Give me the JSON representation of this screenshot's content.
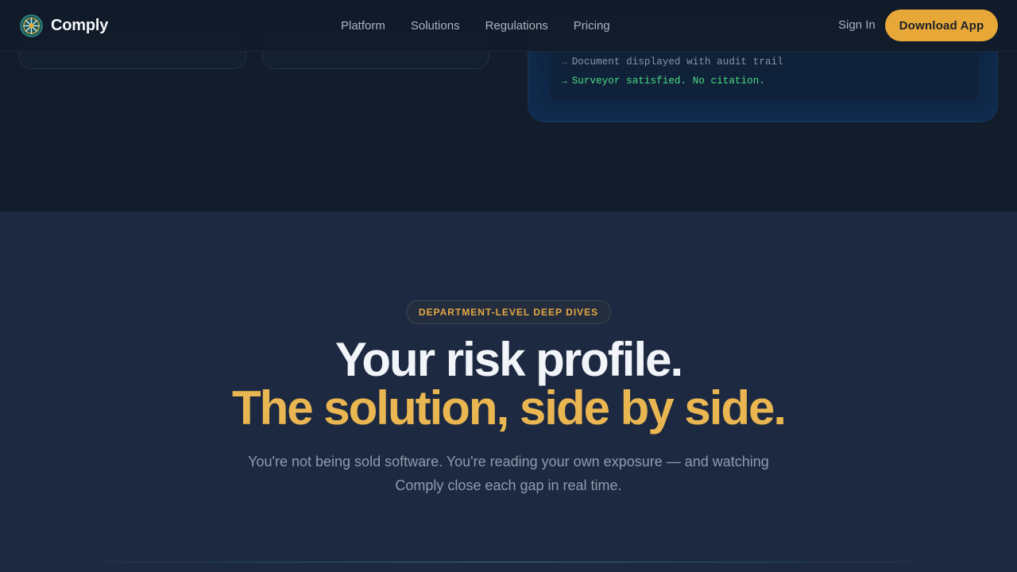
{
  "header": {
    "brand_name": "Comply",
    "logo_icon": "compass-wheel-icon",
    "nav": [
      {
        "label": "Platform"
      },
      {
        "label": "Solutions"
      },
      {
        "label": "Regulations"
      },
      {
        "label": "Pricing"
      }
    ],
    "sign_in_label": "Sign In",
    "download_label": "Download App"
  },
  "terminal": {
    "lines": [
      {
        "arrow": "→",
        "text": "Document displayed with audit trail"
      },
      {
        "arrow": "→",
        "text": "Surveyor satisfied. No citation."
      }
    ]
  },
  "hero": {
    "badge": "DEPARTMENT-LEVEL DEEP DIVES",
    "headline_line1": "Your risk profile.",
    "headline_line2": "The solution, side by side.",
    "subtitle": "You're not being sold software. You're reading your own exposure — and watching Comply close each gap in real time."
  },
  "colors": {
    "accent": "#e8a838",
    "headline_accent": "#eab651",
    "success": "#4ade80",
    "page_background": "#131c2b",
    "hero_background": "#1d2940"
  }
}
